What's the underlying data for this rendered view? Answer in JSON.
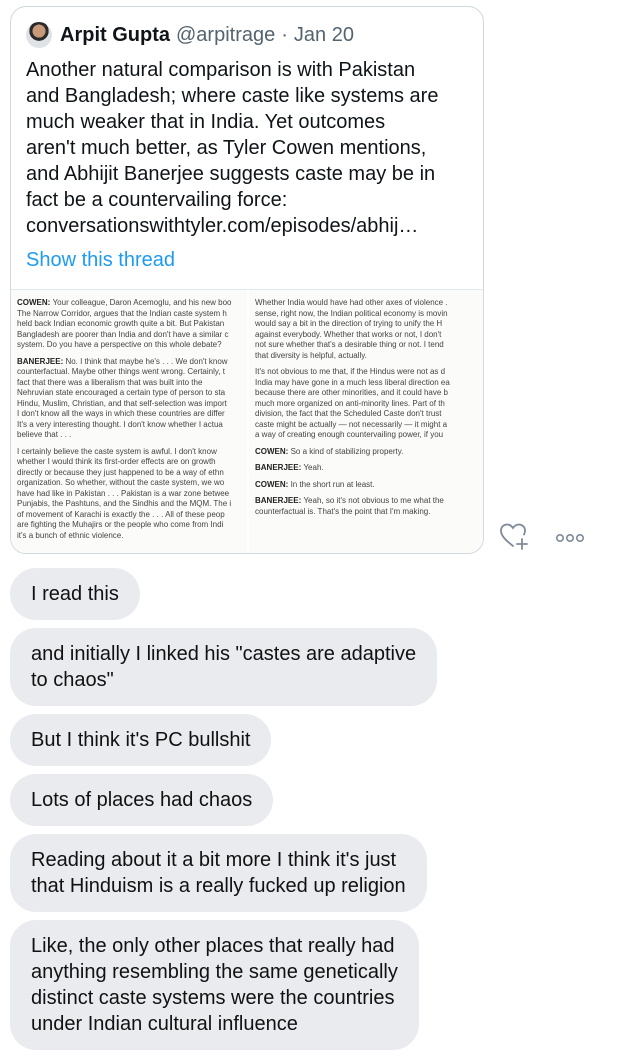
{
  "tweet": {
    "author_name": "Arpit Gupta",
    "author_handle": "@arpitrage",
    "separator": "·",
    "date": "Jan 20",
    "text": "Another natural comparison is with Pakistan\nand Bangladesh; where caste like systems are\nmuch weaker that in India. Yet outcomes\naren't much better, as Tyler Cowen mentions,\nand Abhijit Banerjee suggests caste may be in\nfact be a countervailing force:\n",
    "link": "conversationswithtyler.com/episodes/abhij…",
    "show_thread": "Show this thread",
    "media": {
      "left": [
        {
          "speaker": "COWEN:",
          "lines": [
            "Your colleague, Daron Acemoglu, and his new boo",
            "The Narrow Corridor, argues that the Indian caste system h",
            "held back Indian economic growth quite a bit. But Pakistan",
            "Bangladesh are poorer than India and don't have a similar c",
            "system. Do you have a perspective on this whole debate?"
          ]
        },
        {
          "speaker": "BANERJEE:",
          "lines": [
            "No. I think that maybe he's . . . We don't know",
            "counterfactual. Maybe other things went wrong. Certainly, t",
            "fact that there was a liberalism that was built into the",
            "Nehruvian state encouraged a certain type of person to sta",
            "Hindu, Muslim, Christian, and that self-selection was import",
            "I don't know all the ways in which these countries are differ",
            "It's a very interesting thought. I don't know whether I actua",
            "believe that . . ."
          ]
        },
        {
          "speaker": "",
          "lines": [
            "I certainly believe the caste system is awful. I don't know",
            "whether I would think its first-order effects are on growth",
            "directly or because they just happened to be a way of ethn",
            "organization. So whether, without the caste system, we wo",
            "have had like in Pakistan . . . Pakistan is a war zone betwee",
            "Punjabis, the Pashtuns, and the Sindhis and the MQM. The i",
            "of movement of Karachi is exactly the . . . All of these peop",
            "are fighting the Muhajirs or the people who come from Indi",
            "it's a bunch of ethnic violence."
          ]
        }
      ],
      "right": [
        {
          "speaker": "",
          "lines": [
            "Whether India would have had other axes of violence .",
            "sense, right now, the Indian political economy is movin",
            "would say a bit in the direction of trying to unify the H",
            "against everybody. Whether that works or not, I don't",
            "not sure whether that's a desirable thing or not. I tend",
            "that diversity is helpful, actually."
          ]
        },
        {
          "speaker": "",
          "lines": [
            "It's not obvious to me that, if the Hindus were not as d",
            "India may have gone in a much less liberal direction ea",
            "because there are other minorities, and it could have b",
            "much more organized on anti-minority lines. Part of th",
            "division, the fact that the Scheduled Caste don't trust",
            "caste might be actually — not necessarily — it might a",
            "a way of creating enough countervailing power, if you"
          ]
        },
        {
          "speaker": "COWEN:",
          "lines": [
            "So a kind of stabilizing property."
          ]
        },
        {
          "speaker": "BANERJEE:",
          "lines": [
            "Yeah."
          ]
        },
        {
          "speaker": "COWEN:",
          "lines": [
            "In the short run at least."
          ]
        },
        {
          "speaker": "BANERJEE:",
          "lines": [
            "Yeah, so it's not obvious to me what the",
            "counterfactual is. That's the point that I'm making."
          ]
        }
      ]
    }
  },
  "icons": {
    "heart_add": "heart-add-icon",
    "more": "more-icon"
  },
  "messages": [
    "I read this",
    "and initially I linked his \"castes are adaptive\nto chaos\"",
    "But I think it's PC bullshit",
    "Lots of places had chaos",
    "Reading about it a bit more I think it's just\nthat Hinduism is a really fucked up religion",
    "Like, the only other places that really had\nanything resembling the same genetically\ndistinct caste systems were the countries\nunder Indian cultural influence"
  ]
}
